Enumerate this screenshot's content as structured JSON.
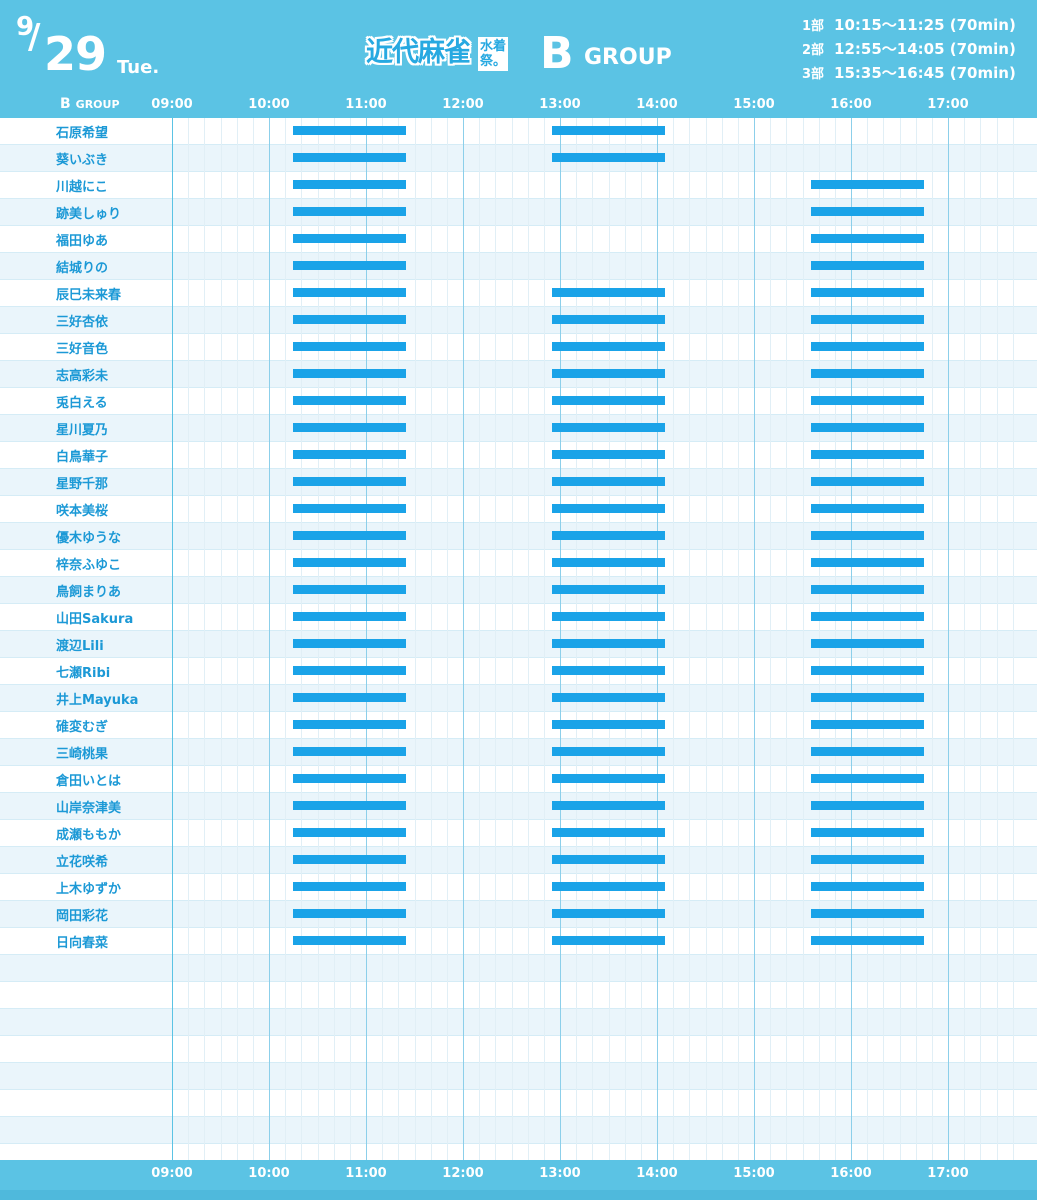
{
  "header": {
    "date_month": "9",
    "date_slash": "/",
    "date_day": "29",
    "date_weekday": "Tue.",
    "logo_main": "近代麻雀",
    "logo_sub": "水着祭。",
    "group_letter": "B",
    "group_word": "GROUP",
    "sessions": [
      {
        "label": "1部",
        "time": "10:15～11:25 (70min)",
        "start": "10:15",
        "end": "11:25"
      },
      {
        "label": "2部",
        "time": "12:55～14:05 (70min)",
        "start": "12:55",
        "end": "14:05"
      },
      {
        "label": "3部",
        "time": "15:35～16:45 (70min)",
        "start": "15:35",
        "end": "16:45"
      }
    ]
  },
  "table": {
    "corner_letter": "B",
    "corner_word": "GROUP",
    "times": [
      "09:00",
      "10:00",
      "11:00",
      "12:00",
      "13:00",
      "14:00",
      "15:00",
      "16:00",
      "17:00"
    ],
    "participants": [
      {
        "name": "石原希望",
        "sessions": [
          1,
          2
        ]
      },
      {
        "name": "葵いぶき",
        "sessions": [
          1,
          2
        ]
      },
      {
        "name": "川越にこ",
        "sessions": [
          1,
          3
        ]
      },
      {
        "name": "跡美しゅり",
        "sessions": [
          1,
          3
        ]
      },
      {
        "name": "福田ゆあ",
        "sessions": [
          1,
          3
        ]
      },
      {
        "name": "結城りの",
        "sessions": [
          1,
          3
        ]
      },
      {
        "name": "辰巳未来春",
        "sessions": [
          1,
          2,
          3
        ]
      },
      {
        "name": "三好杏依",
        "sessions": [
          1,
          2,
          3
        ]
      },
      {
        "name": "三好音色",
        "sessions": [
          1,
          2,
          3
        ]
      },
      {
        "name": "志高彩未",
        "sessions": [
          1,
          2,
          3
        ]
      },
      {
        "name": "兎白える",
        "sessions": [
          1,
          2,
          3
        ]
      },
      {
        "name": "星川夏乃",
        "sessions": [
          1,
          2,
          3
        ]
      },
      {
        "name": "白鳥華子",
        "sessions": [
          1,
          2,
          3
        ]
      },
      {
        "name": "星野千那",
        "sessions": [
          1,
          2,
          3
        ]
      },
      {
        "name": "咲本美桜",
        "sessions": [
          1,
          2,
          3
        ]
      },
      {
        "name": "優木ゆうな",
        "sessions": [
          1,
          2,
          3
        ]
      },
      {
        "name": "梓奈ふゆこ",
        "sessions": [
          1,
          2,
          3
        ]
      },
      {
        "name": "鳥飼まりあ",
        "sessions": [
          1,
          2,
          3
        ]
      },
      {
        "name": "山田Sakura",
        "sessions": [
          1,
          2,
          3
        ]
      },
      {
        "name": "渡辺Lili",
        "sessions": [
          1,
          2,
          3
        ]
      },
      {
        "name": "七瀬Ribi",
        "sessions": [
          1,
          2,
          3
        ]
      },
      {
        "name": "井上Mayuka",
        "sessions": [
          1,
          2,
          3
        ]
      },
      {
        "name": "碓変むぎ",
        "sessions": [
          1,
          2,
          3
        ]
      },
      {
        "name": "三崎桃果",
        "sessions": [
          1,
          2,
          3
        ]
      },
      {
        "name": "倉田いとは",
        "sessions": [
          1,
          2,
          3
        ]
      },
      {
        "name": "山岸奈津美",
        "sessions": [
          1,
          2,
          3
        ]
      },
      {
        "name": "成瀬ももか",
        "sessions": [
          1,
          2,
          3
        ]
      },
      {
        "name": "立花咲希",
        "sessions": [
          1,
          2,
          3
        ]
      },
      {
        "name": "上木ゆずか",
        "sessions": [
          1,
          2,
          3
        ]
      },
      {
        "name": "岡田彩花",
        "sessions": [
          1,
          2,
          3
        ]
      },
      {
        "name": "日向春菜",
        "sessions": [
          1,
          2,
          3
        ]
      }
    ]
  },
  "colors": {
    "header_bg": "#5bc3e4",
    "bar": "#1aa3e8",
    "name_text": "#1c99d6",
    "row_alt": "#eaf5fb"
  }
}
